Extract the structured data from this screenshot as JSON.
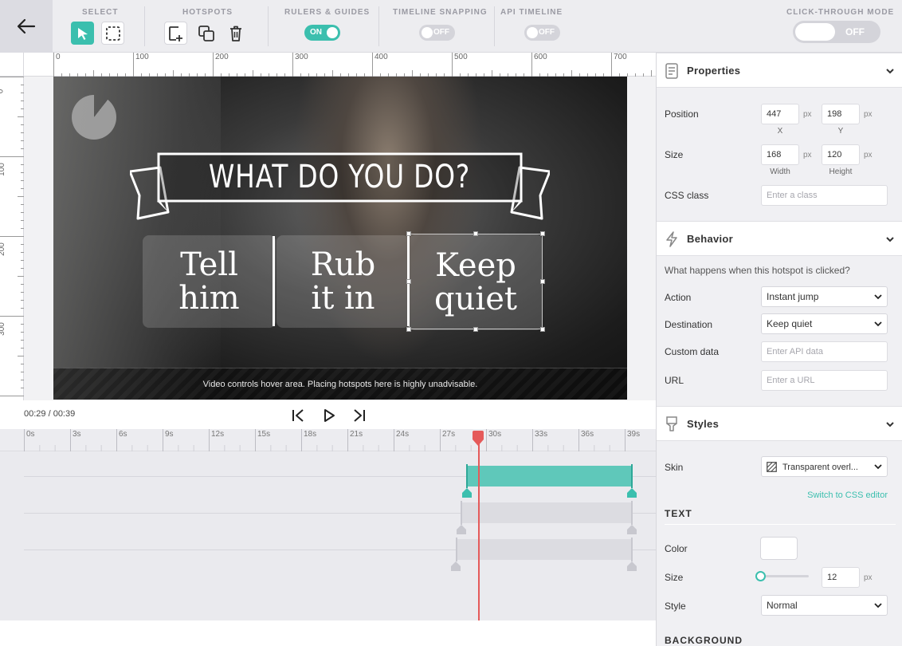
{
  "toolbar": {
    "select_label": "SELECT",
    "hotspots_label": "HOTSPOTS",
    "rulers_label": "RULERS & GUIDES",
    "rulers_toggle": "ON",
    "snapping_label": "TIMELINE SNAPPING",
    "snapping_toggle": "OFF",
    "api_label": "API TIMELINE",
    "api_toggle": "OFF",
    "clickthrough_label": "CLICK-THROUGH MODE",
    "clickthrough_toggle": "OFF"
  },
  "ruler": {
    "top": [
      "0",
      "100",
      "200",
      "300",
      "400",
      "500",
      "600",
      "700"
    ],
    "left": [
      "0",
      "100",
      "200",
      "300"
    ]
  },
  "video": {
    "banner_title": "WHAT DO YOU DO?",
    "choices": [
      {
        "line1": "Tell",
        "line2": "him"
      },
      {
        "line1": "Rub",
        "line2": "it in"
      },
      {
        "line1": "Keep",
        "line2": "quiet"
      }
    ],
    "controls_note": "Video controls hover area. Placing hotspots here is highly unadvisable."
  },
  "playback": {
    "time": "00:29 / 00:39"
  },
  "timeline": {
    "labels": [
      "0s",
      "3s",
      "6s",
      "9s",
      "12s",
      "15s",
      "18s",
      "21s",
      "24s",
      "27s",
      "30s",
      "33s",
      "36s",
      "39s"
    ],
    "playhead_seconds": 29
  },
  "panel": {
    "properties": {
      "title": "Properties",
      "position_label": "Position",
      "x_value": "447",
      "y_value": "198",
      "x_sub": "X",
      "y_sub": "Y",
      "size_label": "Size",
      "width_value": "168",
      "height_value": "120",
      "width_sub": "Width",
      "height_sub": "Height",
      "unit": "px",
      "css_class_label": "CSS class",
      "css_class_placeholder": "Enter a class"
    },
    "behavior": {
      "title": "Behavior",
      "question": "What happens when this hotspot is clicked?",
      "action_label": "Action",
      "action_value": "Instant jump",
      "destination_label": "Destination",
      "destination_value": "Keep quiet",
      "custom_data_label": "Custom data",
      "custom_data_placeholder": "Enter API data",
      "url_label": "URL",
      "url_placeholder": "Enter a URL"
    },
    "styles": {
      "title": "Styles",
      "skin_label": "Skin",
      "skin_value": "Transparent overl...",
      "css_editor_link": "Switch to CSS editor",
      "text_heading": "TEXT",
      "color_label": "Color",
      "size_label": "Size",
      "size_value": "12",
      "size_unit": "px",
      "style_label": "Style",
      "style_value": "Normal",
      "background_heading": "BACKGROUND"
    }
  },
  "colors": {
    "accent": "#3bbfae",
    "playhead": "#e55a5a"
  }
}
